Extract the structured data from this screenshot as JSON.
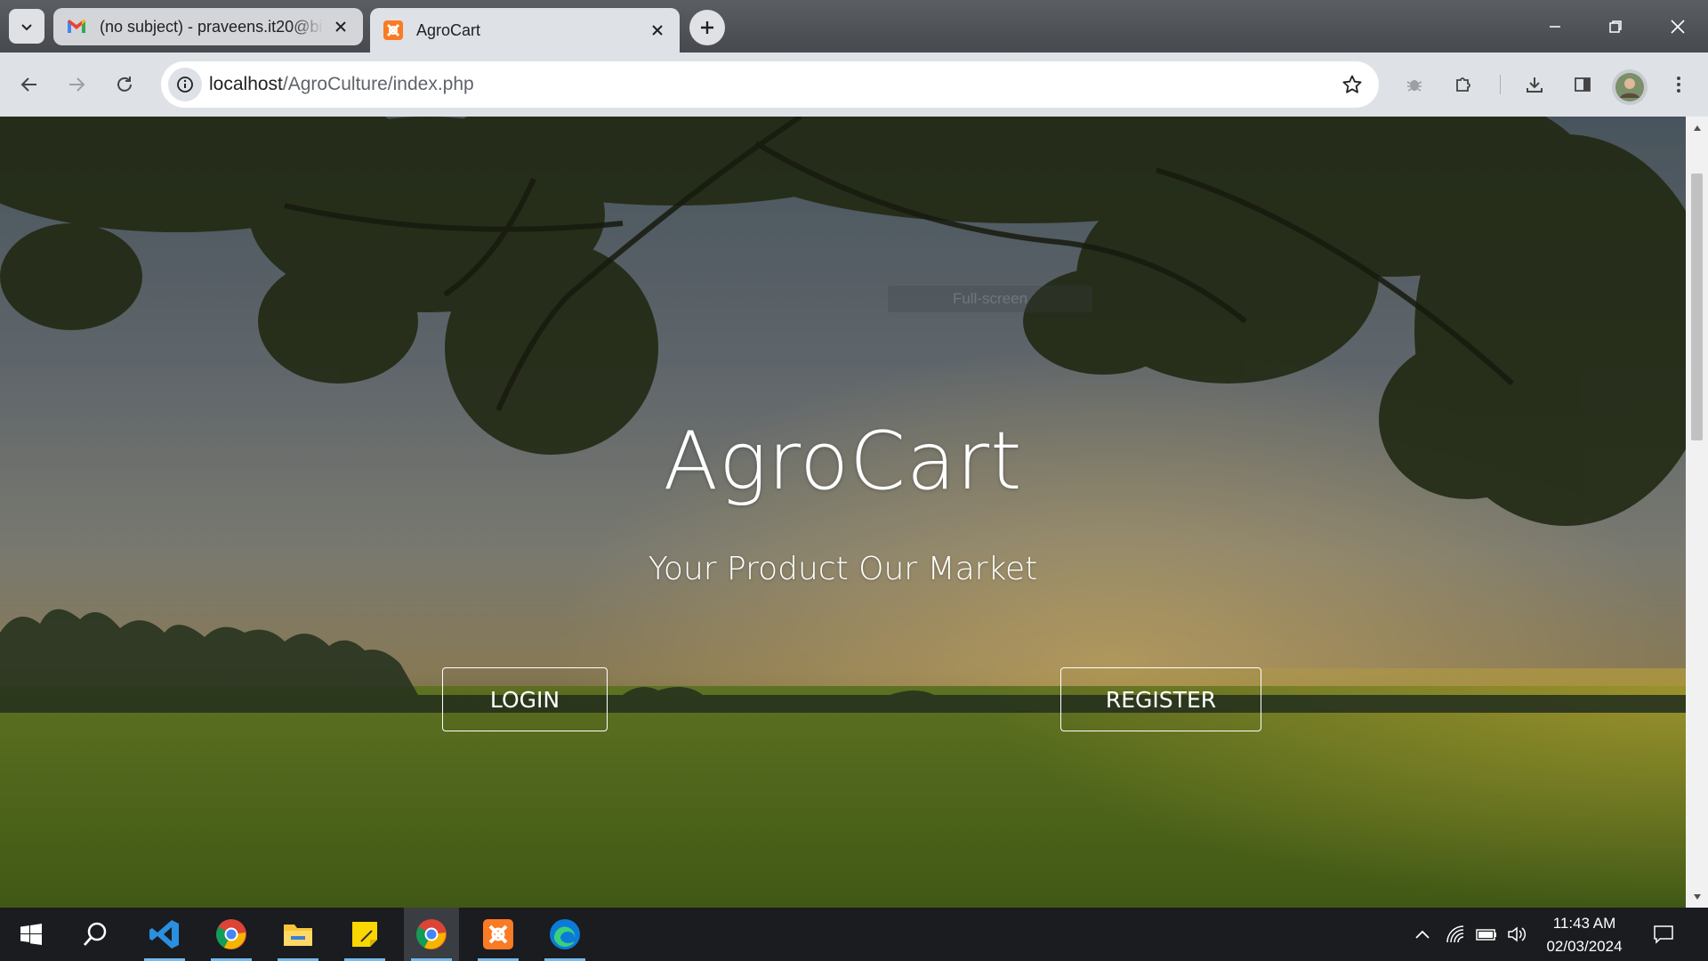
{
  "browser": {
    "tabs": [
      {
        "title": "(no subject) - praveens.it20@bi",
        "favicon": "gmail-icon",
        "active": false
      },
      {
        "title": "AgroCart",
        "favicon": "xampp-icon",
        "active": true
      }
    ],
    "url": {
      "host": "localhost",
      "path": "/AgroCulture/index.php"
    }
  },
  "page": {
    "fullscreen_hint": "Full-screen",
    "title": "AgroCart",
    "subtitle": "Your Product Our Market",
    "login_label": "LOGIN",
    "register_label": "REGISTER"
  },
  "taskbar": {
    "apps": [
      "windows-start-icon",
      "search-icon",
      "vscode-icon",
      "chrome-icon",
      "file-explorer-icon",
      "sticky-notes-icon",
      "chrome-icon",
      "xampp-icon",
      "edge-icon"
    ],
    "time": "11:43 AM",
    "date": "02/03/2024"
  },
  "colors": {
    "tabstrip": "#46494d",
    "toolbar": "#dee1e6",
    "taskbar": "#1a1c1f",
    "accent_underline": "#76b9ed",
    "gmail_red": "#ea4335",
    "xampp_orange": "#fb7a24"
  }
}
